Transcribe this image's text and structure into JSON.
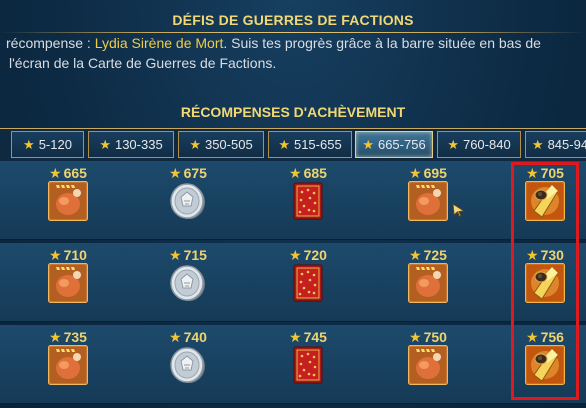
{
  "header": {
    "title": "DÉFIS DE GUERRES DE FACTIONS"
  },
  "description": {
    "line1_pre": "récompense : ",
    "line1_highlight": "Lydia Sirène de Mort",
    "line1_post": ". Suis tes progrès grâce à la barre située en bas de",
    "line2": "l'écran de la Carte de Guerres de Factions."
  },
  "section": {
    "title": "RÉCOMPENSES D'ACHÈVEMENT"
  },
  "tabs": [
    {
      "label": "5-120",
      "active": false
    },
    {
      "label": "130-335",
      "active": false
    },
    {
      "label": "350-505",
      "active": false
    },
    {
      "label": "515-655",
      "active": false
    },
    {
      "label": "665-756",
      "active": true
    },
    {
      "label": "760-840",
      "active": false
    },
    {
      "label": "845-94",
      "active": false
    }
  ],
  "rows": [
    {
      "cells": [
        {
          "value": "665",
          "icon": "chicken-icon"
        },
        {
          "value": "675",
          "icon": "silver-coin-icon"
        },
        {
          "value": "685",
          "icon": "red-tome-icon"
        },
        {
          "value": "695",
          "icon": "chicken-icon"
        },
        {
          "value": "705",
          "icon": "gold-shard-icon"
        }
      ]
    },
    {
      "cells": [
        {
          "value": "710",
          "icon": "chicken-icon"
        },
        {
          "value": "715",
          "icon": "silver-coin-icon"
        },
        {
          "value": "720",
          "icon": "red-tome-icon"
        },
        {
          "value": "725",
          "icon": "chicken-icon"
        },
        {
          "value": "730",
          "icon": "gold-shard-icon"
        }
      ]
    },
    {
      "cells": [
        {
          "value": "735",
          "icon": "chicken-icon"
        },
        {
          "value": "740",
          "icon": "silver-coin-icon"
        },
        {
          "value": "745",
          "icon": "red-tome-icon"
        },
        {
          "value": "750",
          "icon": "chicken-icon"
        },
        {
          "value": "756",
          "icon": "gold-shard-icon"
        }
      ]
    }
  ],
  "colors": {
    "gold_text": "#f1d874",
    "highlight_border": "#e0191e",
    "background": "#0c2a43"
  }
}
